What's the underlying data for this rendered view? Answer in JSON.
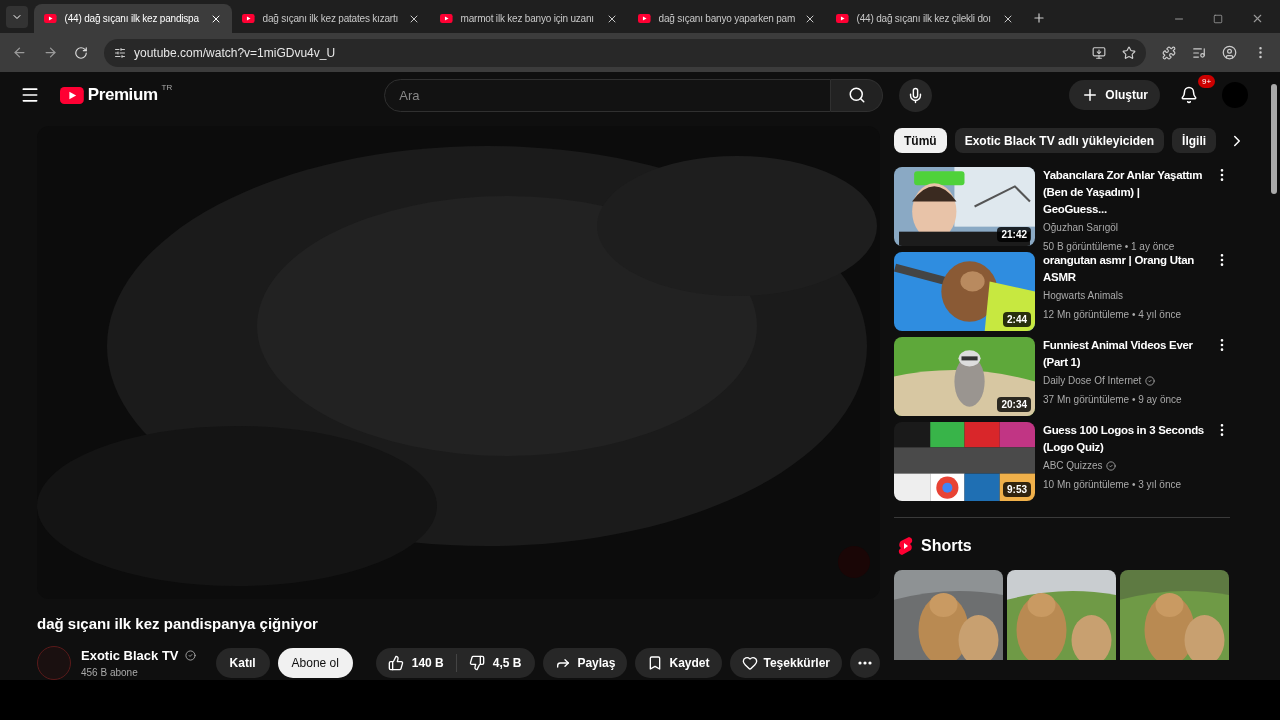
{
  "browser": {
    "tabs": [
      {
        "title": "(44) dağ sıçanı ilk kez pandispa",
        "selected": true
      },
      {
        "title": "dağ sıçanı ilk kez patates kızartı",
        "selected": false
      },
      {
        "title": "marmot ilk kez banyo için uzanı",
        "selected": false
      },
      {
        "title": "dağ sıçanı banyo yaparken pam",
        "selected": false
      },
      {
        "title": "(44) dağ sıçanı ilk kez çilekli doı",
        "selected": false
      }
    ],
    "url": "youtube.com/watch?v=1miGDvu4v_U"
  },
  "header": {
    "logo": "Premium",
    "country": "TR",
    "search_placeholder": "Ara",
    "create": "Oluştur",
    "notifications": "9+"
  },
  "video": {
    "title": "dağ sıçanı ilk kez pandispanya çiğniyor",
    "channel": "Exotic Black TV",
    "channel_verified": true,
    "subscribers": "456 B abone",
    "join": "Katıl",
    "subscribe": "Abone ol",
    "likes": "140 B",
    "dislikes": "4,5 B",
    "share": "Paylaş",
    "save": "Kaydet",
    "thanks": "Teşekkürler"
  },
  "chips": [
    {
      "label": "Tümü",
      "selected": true
    },
    {
      "label": "Exotic Black TV adlı yükleyiciden",
      "selected": false
    },
    {
      "label": "İlgili",
      "selected": false
    }
  ],
  "recommended": [
    {
      "title": "Yabancılara Zor Anlar Yaşattım (Ben de Yaşadım)  | GeoGuess...",
      "channel": "Oğuzhan Sarıgöl",
      "verified": false,
      "meta": "50 B görüntüleme • 1 ay önce",
      "duration": "21:42",
      "kind": "person"
    },
    {
      "title": "orangutan asmr | Orang Utan ASMR",
      "channel": "Hogwarts Animals",
      "verified": false,
      "meta": "12 Mn görüntüleme • 4 yıl önce",
      "duration": "2:44",
      "kind": "animal"
    },
    {
      "title": "Funniest Animal Videos Ever (Part 1)",
      "channel": "Daily Dose Of Internet",
      "verified": true,
      "meta": "37 Mn görüntüleme • 9 ay önce",
      "duration": "20:34",
      "kind": "grass"
    },
    {
      "title": "Guess 100 Logos in 3 Seconds (Logo Quiz)",
      "channel": "ABC Quizzes",
      "verified": true,
      "meta": "10 Mn görüntüleme • 3 yıl önce",
      "duration": "9:53",
      "kind": "grid"
    }
  ],
  "shorts": {
    "title": "Shorts"
  }
}
